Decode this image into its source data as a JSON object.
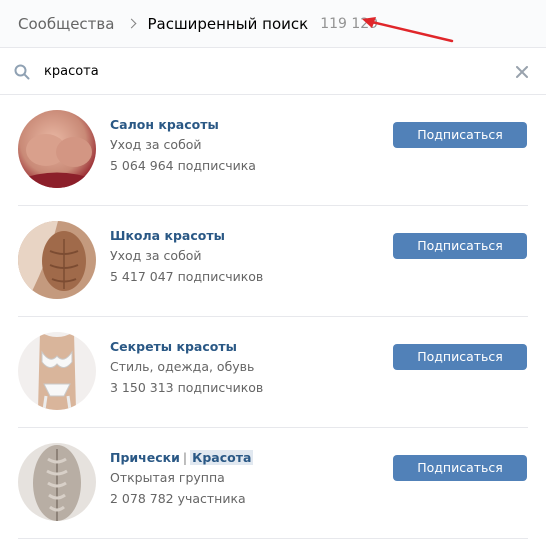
{
  "breadcrumb": {
    "parent": "Сообщества",
    "current": "Расширенный поиск",
    "count": "119 129"
  },
  "search": {
    "value": "красота"
  },
  "subscribe_label": "Подписаться",
  "communities": [
    {
      "name": "Салон красоты",
      "category": "Уход за собой",
      "members": "5 064 964 подписчика"
    },
    {
      "name": "Школа красоты",
      "category": "Уход за собой",
      "members": "5 417 047 подписчиков"
    },
    {
      "name": "Секреты красоты",
      "category": "Стиль, одежда, обувь",
      "members": "3 150 313 подписчиков"
    },
    {
      "name_part1": "Прически",
      "name_sep": "|",
      "name_part2": "Красота",
      "category": "Открытая группа",
      "members": "2 078 782 участника"
    }
  ],
  "colors": {
    "accent": "#5181b8",
    "link": "#2a5885",
    "annotation_arrow": "#e0262a"
  }
}
